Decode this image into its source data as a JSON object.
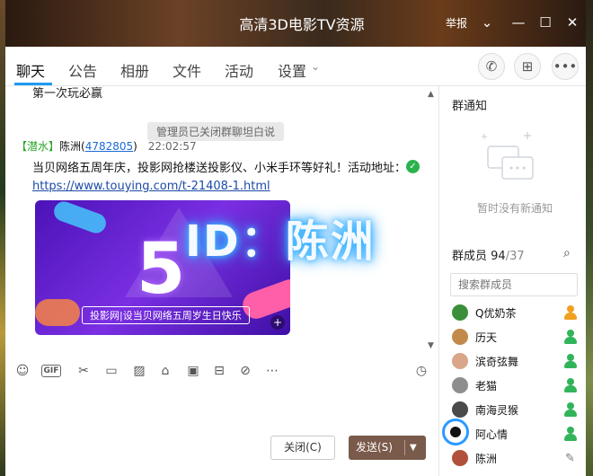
{
  "window": {
    "title": "高清3D电影TV资源",
    "report_label": "举报"
  },
  "tabs": [
    {
      "label": "聊天"
    },
    {
      "label": "公告"
    },
    {
      "label": "相册"
    },
    {
      "label": "文件"
    },
    {
      "label": "活动"
    },
    {
      "label": "设置"
    }
  ],
  "chat": {
    "clipped_text": "第一次玩必赢",
    "system_message": "管理员已关闭群聊坦白说",
    "sender": {
      "level": "【潜水】",
      "name": "陈洲",
      "uid_open": "(",
      "uid": "4782805",
      "uid_close": ")",
      "time": "22:02:57"
    },
    "message_text": "当贝网络五周年庆，投影网抢楼送投影仪、小米手环等好礼！活动地址：",
    "message_link": "https://www.touying.com/t-21408-1.html",
    "promo_number": "5",
    "promo_caption": "投影网|设当贝网络五周岁生日快乐",
    "watermark": "ID：陈洲"
  },
  "composer": {
    "close_label": "关闭(C)",
    "send_label": "发送(S)",
    "gif_label": "GIF"
  },
  "panel": {
    "notice_title": "群通知",
    "notice_empty": "暂时没有新通知",
    "members_title": "群成员",
    "members_online": "94",
    "members_total": "/37",
    "search_placeholder": "搜索群成员",
    "members": [
      {
        "name": "Q优奶茶",
        "role_color": "#f0a020"
      },
      {
        "name": "历天",
        "role_color": "#32b45a"
      },
      {
        "name": "滨奇弦舞",
        "role_color": "#32b45a"
      },
      {
        "name": "老猫",
        "role_color": "#32b45a"
      },
      {
        "name": "南海灵猴",
        "role_color": "#32b45a"
      },
      {
        "name": "阿心情",
        "role_color": "#32b45a"
      },
      {
        "name": "陈洲",
        "role_color": "#32b45a"
      }
    ]
  }
}
